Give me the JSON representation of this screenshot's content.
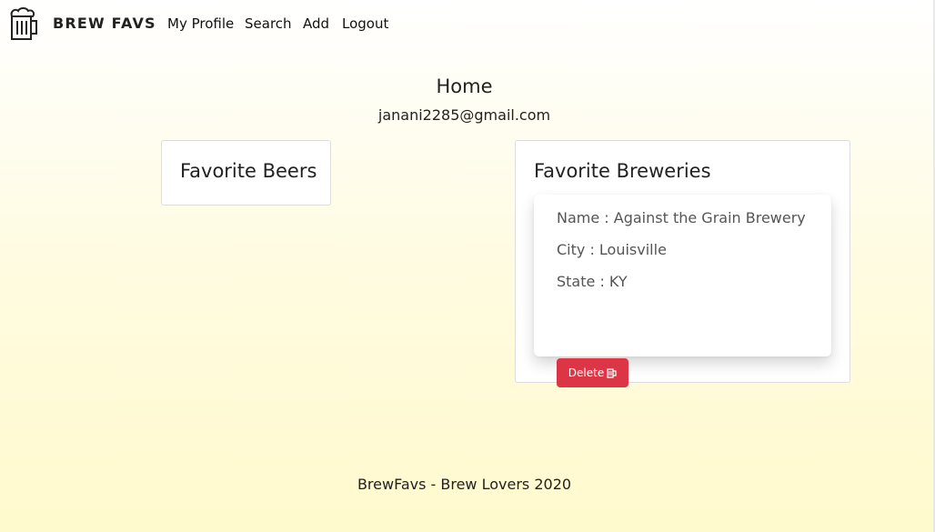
{
  "nav": {
    "brand_icon": "beer-mug-icon",
    "brand": "BREW FAVS",
    "links": [
      "My Profile",
      "Search",
      "Add",
      "Logout"
    ]
  },
  "main": {
    "title": "Home",
    "email": "janani2285@gmail.com",
    "favorite_beers": {
      "title": "Favorite Beers"
    },
    "favorite_breweries": {
      "title": "Favorite Breweries",
      "items": [
        {
          "name": "Name : Against the Grain Brewery",
          "city": "City : Louisville",
          "state": "State : KY",
          "delete_label": "Delete",
          "delete_icon": "beer-mug-icon"
        }
      ]
    }
  },
  "footer": {
    "text": "BrewFavs - Brew Lovers 2020"
  },
  "colors": {
    "danger": "#dc3545",
    "background_bottom": "#fffacd"
  }
}
